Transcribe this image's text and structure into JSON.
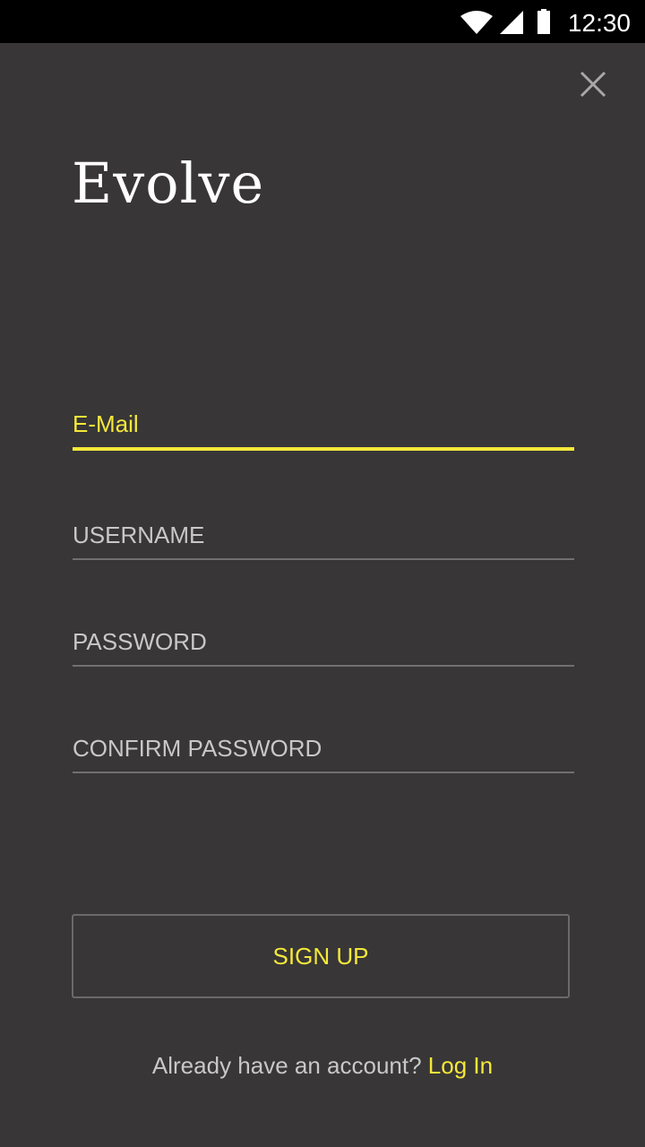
{
  "status": {
    "time": "12:30"
  },
  "app": {
    "logo": "Evolve"
  },
  "form": {
    "email_placeholder": "E-Mail",
    "username_placeholder": "USERNAME",
    "password_placeholder": "PASSWORD",
    "confirm_placeholder": "CONFIRM PASSWORD"
  },
  "actions": {
    "signup_label": "SIGN UP",
    "footer_text": "Already have an account?",
    "login_link": "Log In"
  },
  "colors": {
    "accent": "#f4e83a",
    "background": "#383637"
  }
}
